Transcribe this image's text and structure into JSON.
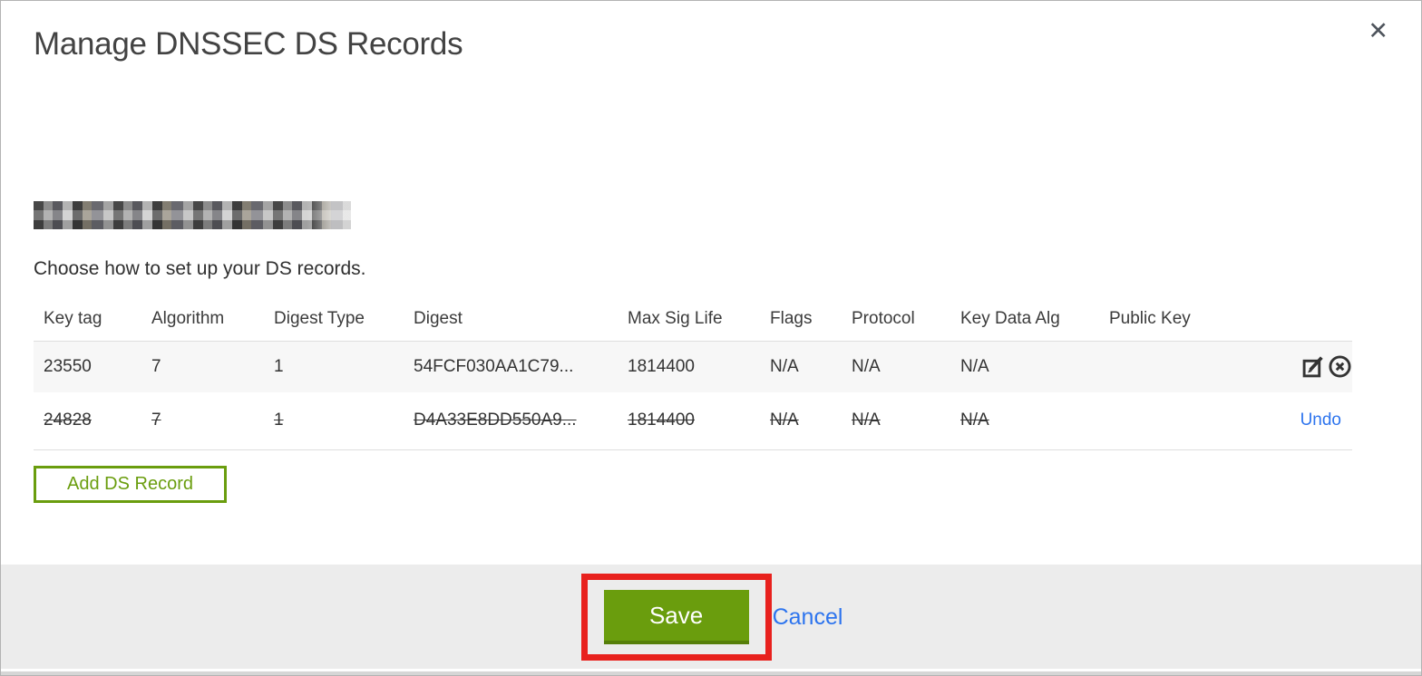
{
  "modal": {
    "title": "Manage DNSSEC DS Records",
    "subtitle": "Choose how to set up your DS records.",
    "domain_redacted": true
  },
  "icons": {
    "close": "✕",
    "edit": "edit-icon",
    "delete": "delete-icon"
  },
  "table": {
    "columns": [
      "Key tag",
      "Algorithm",
      "Digest Type",
      "Digest",
      "Max Sig Life",
      "Flags",
      "Protocol",
      "Key Data Alg",
      "Public Key"
    ],
    "rows": [
      {
        "key_tag": "23550",
        "algorithm": "7",
        "digest_type": "1",
        "digest": "54FCF030AA1C79...",
        "max_sig_life": "1814400",
        "flags": "N/A",
        "protocol": "N/A",
        "key_data_alg": "N/A",
        "public_key": "",
        "state": "active"
      },
      {
        "key_tag": "24828",
        "algorithm": "7",
        "digest_type": "1",
        "digest": "D4A33E8DD550A9...",
        "max_sig_life": "1814400",
        "flags": "N/A",
        "protocol": "N/A",
        "key_data_alg": "N/A",
        "public_key": "",
        "state": "marked-for-deletion",
        "undo_label": "Undo"
      }
    ]
  },
  "buttons": {
    "add_ds_record": "Add DS Record",
    "save": "Save",
    "cancel": "Cancel"
  },
  "annotation": {
    "shape": "rectangle",
    "target": "save-button",
    "color": "#e8211d"
  },
  "colors": {
    "accent_green": "#6a9d0e",
    "save_button_bg": "#6a9d0d",
    "link_blue": "#2d74ee",
    "footer_bg": "#ececec",
    "row_stripe_bg": "#f7f7f7",
    "annotation_red": "#e8211d"
  }
}
